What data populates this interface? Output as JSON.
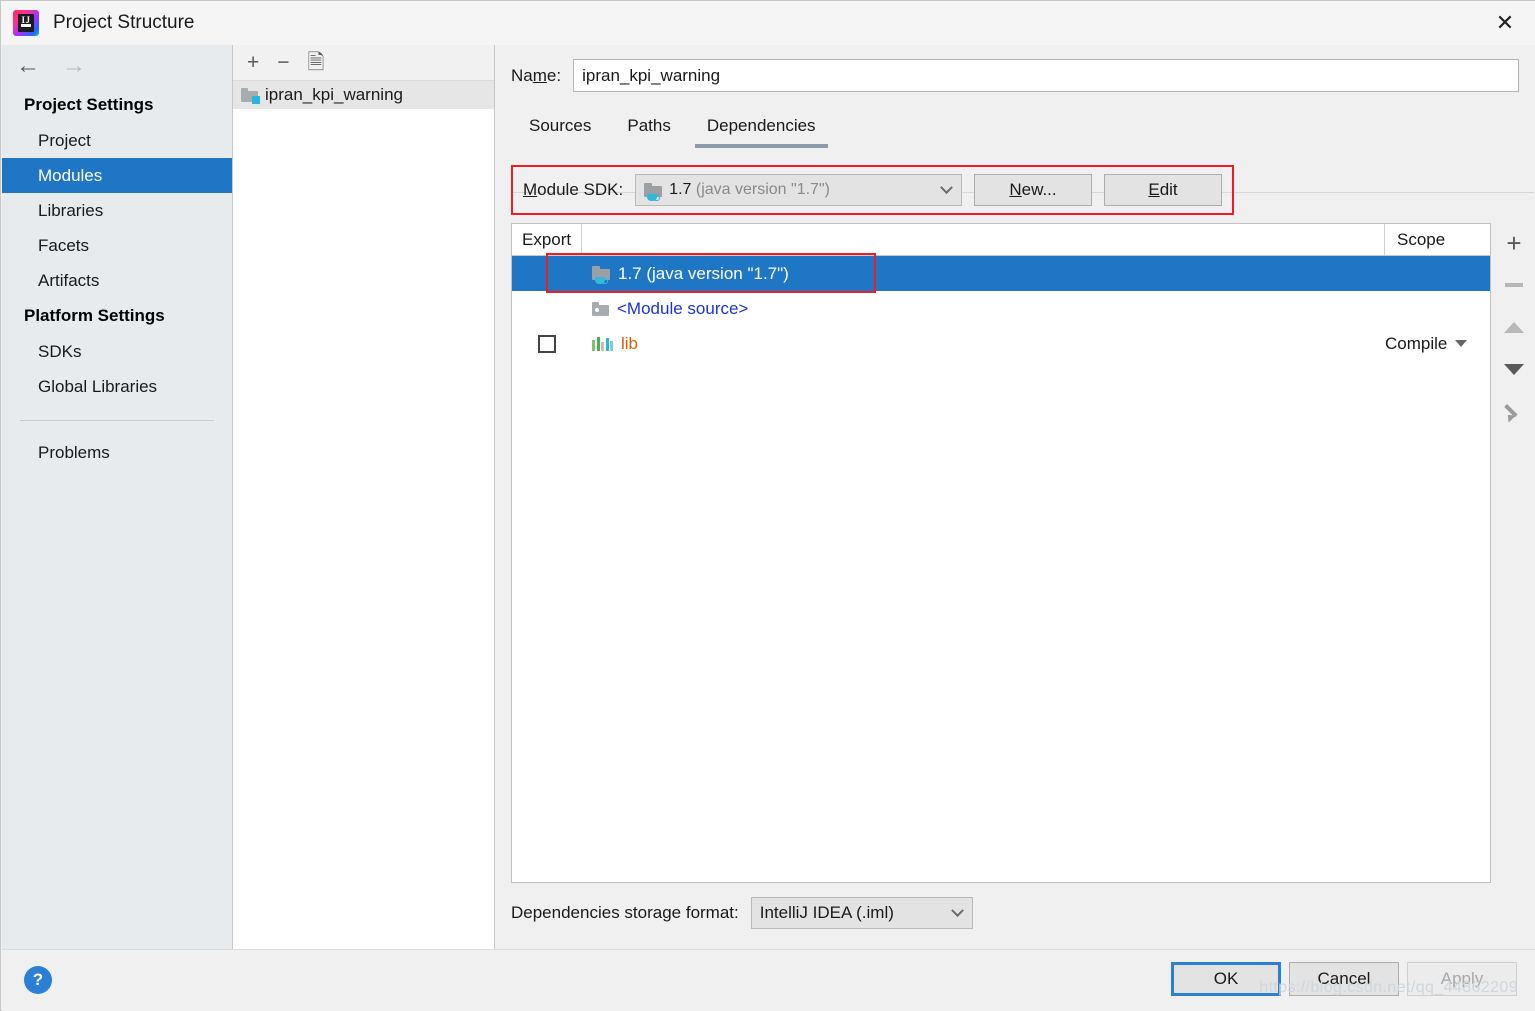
{
  "window": {
    "title": "Project Structure",
    "logo_text": "IJ",
    "close_label": "✕"
  },
  "navigation": {
    "back_icon": "arrow-left-icon",
    "forward_icon": "arrow-right-icon"
  },
  "sidebar": {
    "groups": [
      {
        "title": "Project Settings",
        "items": [
          {
            "label": "Project",
            "selected": false
          },
          {
            "label": "Modules",
            "selected": true
          },
          {
            "label": "Libraries",
            "selected": false
          },
          {
            "label": "Facets",
            "selected": false
          },
          {
            "label": "Artifacts",
            "selected": false
          }
        ]
      },
      {
        "title": "Platform Settings",
        "items": [
          {
            "label": "SDKs",
            "selected": false
          },
          {
            "label": "Global Libraries",
            "selected": false
          }
        ]
      }
    ],
    "problems_label": "Problems"
  },
  "module_panel": {
    "toolbar": {
      "add_label": "+",
      "remove_label": "−",
      "copy_label": "copy-icon"
    },
    "modules": [
      {
        "label": "ipran_kpi_warning",
        "selected": true,
        "icon": "module-folder-icon"
      }
    ]
  },
  "main": {
    "name_label_pre": "Na",
    "name_label_mnemonic": "m",
    "name_label_post": "e:",
    "name_value": "ipran_kpi_warning",
    "name_placeholder": "",
    "tabs": [
      {
        "label": "Sources",
        "active": false
      },
      {
        "label": "Paths",
        "active": false
      },
      {
        "label": "Dependencies",
        "active": true
      }
    ],
    "sdk": {
      "label_mnemonic": "M",
      "label_post": "odule SDK:",
      "value_version": "1.7",
      "value_detail": "(java version \"1.7\")",
      "new_button_mnemonic": "N",
      "new_button_post": "ew...",
      "edit_button_pre": "E",
      "edit_button_post": "dit"
    },
    "table": {
      "columns": {
        "export": "Export",
        "scope": "Scope"
      },
      "rows": [
        {
          "name": "1.7 (java version \"1.7\")",
          "icon": "jdk-folder-icon",
          "selected": true,
          "has_checkbox": false,
          "checked": false,
          "scope": "",
          "highlighted": true
        },
        {
          "name": "<Module source>",
          "icon": "module-source-icon",
          "selected": false,
          "has_checkbox": false,
          "checked": false,
          "scope": "",
          "highlighted": false
        },
        {
          "name": "lib",
          "icon": "library-books-icon",
          "selected": false,
          "has_checkbox": true,
          "checked": false,
          "scope": "Compile",
          "highlighted": false
        }
      ]
    },
    "table_toolbar": {
      "add": "+",
      "remove": "−",
      "move_up": "move-up-icon",
      "move_down": "move-down-icon",
      "edit": "pencil-icon"
    },
    "storage": {
      "label": "Dependencies storage format:",
      "value": "IntelliJ IDEA (.iml)"
    }
  },
  "footer": {
    "help_label": "?",
    "ok_label": "OK",
    "cancel_label": "Cancel",
    "apply_label": "Apply"
  },
  "watermark": "https://blog.csdn.net/qq_44862209",
  "colors": {
    "selection_blue": "#1e76c4",
    "highlight_red": "#ee1c25",
    "link_blue": "#1a34d8",
    "library_orange": "#d4600a",
    "focus_blue": "#2b7fd4"
  }
}
